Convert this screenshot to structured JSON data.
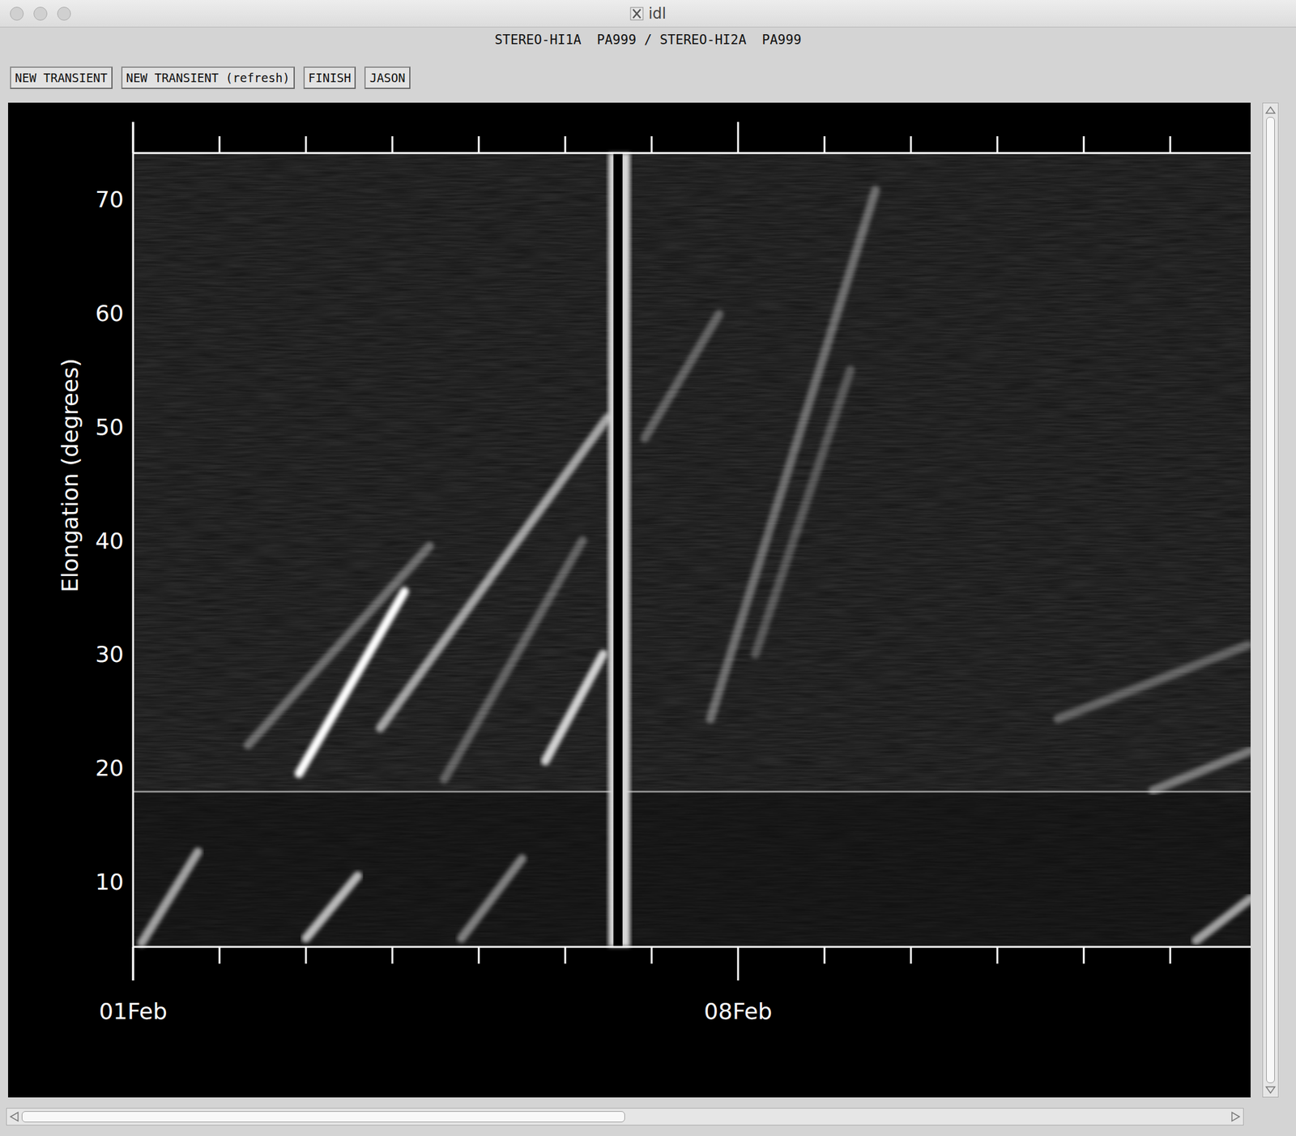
{
  "window": {
    "title": "idl"
  },
  "subtitle": "STEREO-HI1A  PA999 / STEREO-HI2A  PA999",
  "buttons": [
    {
      "label": "NEW TRANSIENT"
    },
    {
      "label": "NEW TRANSIENT (refresh)"
    },
    {
      "label": "FINISH"
    },
    {
      "label": "JASON"
    }
  ],
  "chart": {
    "y_label": "Elongation (degrees)",
    "y_ticks": [
      "10",
      "20",
      "30",
      "40",
      "50",
      "60",
      "70"
    ],
    "y_min": 4.25,
    "y_max": 74.07,
    "x_days": 12.93,
    "x_labels": [
      {
        "label": "01Feb",
        "day": 0
      },
      {
        "label": "08Feb",
        "day": 7
      }
    ],
    "instrument_boundary": 17.9,
    "gaps": [
      {
        "start": 5.5,
        "end": 5.75
      }
    ],
    "tracks": [
      {
        "days": [
          1.92,
          3.14
        ],
        "elongation": [
          19.5,
          35.5
        ],
        "level": 1.0
      },
      {
        "days": [
          2.86,
          5.49
        ],
        "elongation": [
          23.5,
          50.8
        ],
        "level": 0.6
      },
      {
        "days": [
          4.77,
          5.44
        ],
        "elongation": [
          20.6,
          30.0
        ],
        "level": 0.8
      },
      {
        "days": [
          1.33,
          3.43
        ],
        "elongation": [
          22.0,
          39.5
        ],
        "level": 0.35
      },
      {
        "days": [
          3.6,
          5.2
        ],
        "elongation": [
          19.0,
          40.0
        ],
        "level": 0.3
      },
      {
        "days": [
          6.68,
          8.59
        ],
        "elongation": [
          24.3,
          70.8
        ],
        "level": 0.35
      },
      {
        "days": [
          5.92,
          6.78
        ],
        "elongation": [
          49.0,
          59.9
        ],
        "level": 0.3
      },
      {
        "days": [
          7.2,
          8.3
        ],
        "elongation": [
          30.0,
          55.0
        ],
        "level": 0.25
      },
      {
        "days": [
          10.7,
          12.9
        ],
        "elongation": [
          24.3,
          30.8
        ],
        "level": 0.3
      },
      {
        "days": [
          11.8,
          12.93
        ],
        "elongation": [
          18.0,
          21.5
        ],
        "level": 0.4
      },
      {
        "days": [
          0.1,
          0.75
        ],
        "elongation": [
          4.6,
          12.6
        ],
        "level": 0.6
      },
      {
        "days": [
          2.0,
          2.6
        ],
        "elongation": [
          5.0,
          10.5
        ],
        "level": 0.7
      },
      {
        "days": [
          3.8,
          4.5
        ],
        "elongation": [
          5.0,
          12.0
        ],
        "level": 0.45
      },
      {
        "days": [
          12.3,
          12.93
        ],
        "elongation": [
          4.8,
          8.5
        ],
        "level": 0.6
      }
    ]
  },
  "scrollbars": {
    "vertical": {
      "level": 1.0,
      "position": 0.0
    },
    "horizontal": {
      "level": 0.5,
      "position": 0.0
    }
  }
}
